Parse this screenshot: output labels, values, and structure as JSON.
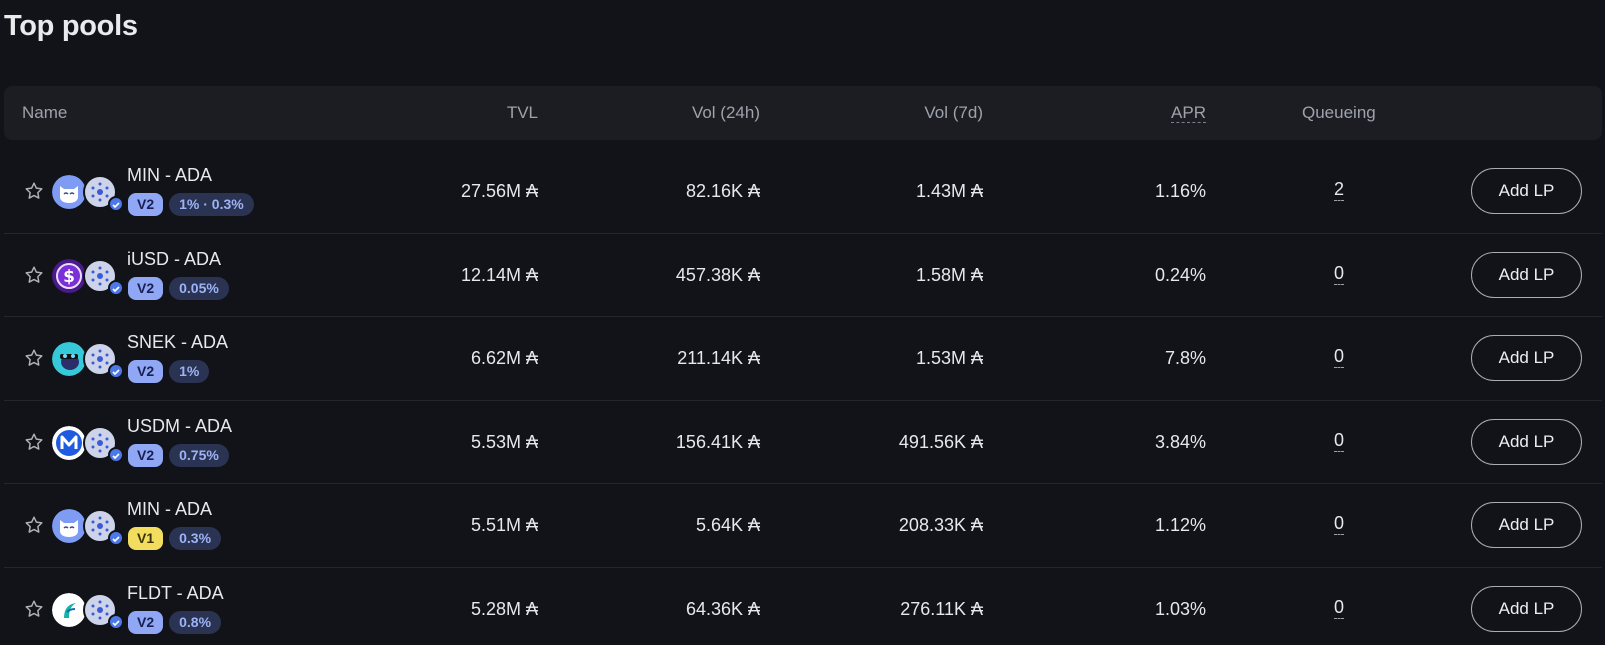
{
  "page": {
    "title": "Top pools"
  },
  "table": {
    "headers": {
      "name": "Name",
      "tvl": "TVL",
      "vol24": "Vol (24h)",
      "vol7": "Vol (7d)",
      "apr": "APR",
      "queueing": "Queueing"
    },
    "rows": [
      {
        "pair": "MIN - ADA",
        "version": "V2",
        "fee": "1% · 0.3%",
        "tvl": "27.56M ₳",
        "vol24": "82.16K ₳",
        "vol7": "1.43M ₳",
        "apr": "1.16%",
        "queue": "2",
        "action": "Add LP",
        "token_icon": "min-cat-icon"
      },
      {
        "pair": "iUSD - ADA",
        "version": "V2",
        "fee": "0.05%",
        "tvl": "12.14M ₳",
        "vol24": "457.38K ₳",
        "vol7": "1.58M ₳",
        "apr": "0.24%",
        "queue": "0",
        "action": "Add LP",
        "token_icon": "iusd-dollar-icon"
      },
      {
        "pair": "SNEK - ADA",
        "version": "V2",
        "fee": "1%",
        "tvl": "6.62M ₳",
        "vol24": "211.14K ₳",
        "vol7": "1.53M ₳",
        "apr": "7.8%",
        "queue": "0",
        "action": "Add LP",
        "token_icon": "snek-icon"
      },
      {
        "pair": "USDM - ADA",
        "version": "V2",
        "fee": "0.75%",
        "tvl": "5.53M ₳",
        "vol24": "156.41K ₳",
        "vol7": "491.56K ₳",
        "apr": "3.84%",
        "queue": "0",
        "action": "Add LP",
        "token_icon": "usdm-icon"
      },
      {
        "pair": "MIN - ADA",
        "version": "V1",
        "fee": "0.3%",
        "tvl": "5.51M ₳",
        "vol24": "5.64K ₳",
        "vol7": "208.33K ₳",
        "apr": "1.12%",
        "queue": "0",
        "action": "Add LP",
        "token_icon": "min-cat-icon"
      },
      {
        "pair": "FLDT - ADA",
        "version": "V2",
        "fee": "0.8%",
        "tvl": "5.28M ₳",
        "vol24": "64.36K ₳",
        "vol7": "276.11K ₳",
        "apr": "1.03%",
        "queue": "0",
        "action": "Add LP",
        "token_icon": "fldt-icon"
      }
    ]
  },
  "colors": {
    "background": "#111318",
    "header_bg": "#1b1d22",
    "v2_badge": "#8fa7f5",
    "v1_badge": "#f3dd5e",
    "fee_badge": "#2b3352",
    "verified": "#4d79e8"
  }
}
